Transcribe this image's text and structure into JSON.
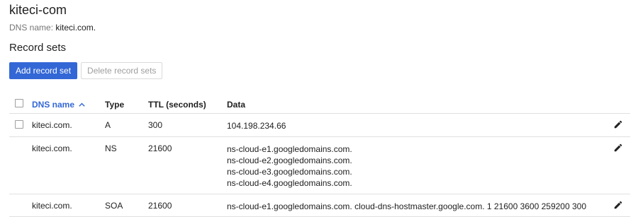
{
  "zone": {
    "title": "kiteci-com",
    "dns_name_label": "DNS name:",
    "dns_name_value": "kiteci.com."
  },
  "record_sets": {
    "title": "Record sets",
    "add_button": "Add record set",
    "delete_button": "Delete record sets"
  },
  "table": {
    "headers": {
      "dns_name": "DNS name",
      "type": "Type",
      "ttl": "TTL (seconds)",
      "data": "Data"
    },
    "rows": [
      {
        "dns_name": "kiteci.com.",
        "type": "A",
        "ttl": "300",
        "data": [
          "104.198.234.66"
        ]
      },
      {
        "dns_name": "kiteci.com.",
        "type": "NS",
        "ttl": "21600",
        "data": [
          "ns-cloud-e1.googledomains.com.",
          "ns-cloud-e2.googledomains.com.",
          "ns-cloud-e3.googledomains.com.",
          "ns-cloud-e4.googledomains.com."
        ]
      },
      {
        "dns_name": "kiteci.com.",
        "type": "SOA",
        "ttl": "21600",
        "data": [
          "ns-cloud-e1.googledomains.com. cloud-dns-hostmaster.google.com. 1 21600 3600 259200 300"
        ]
      }
    ]
  },
  "icons": {
    "sort": "sort-ascending-icon",
    "edit": "pencil-icon"
  },
  "colors": {
    "primary": "#3367d6",
    "border": "#e0e0e0"
  }
}
